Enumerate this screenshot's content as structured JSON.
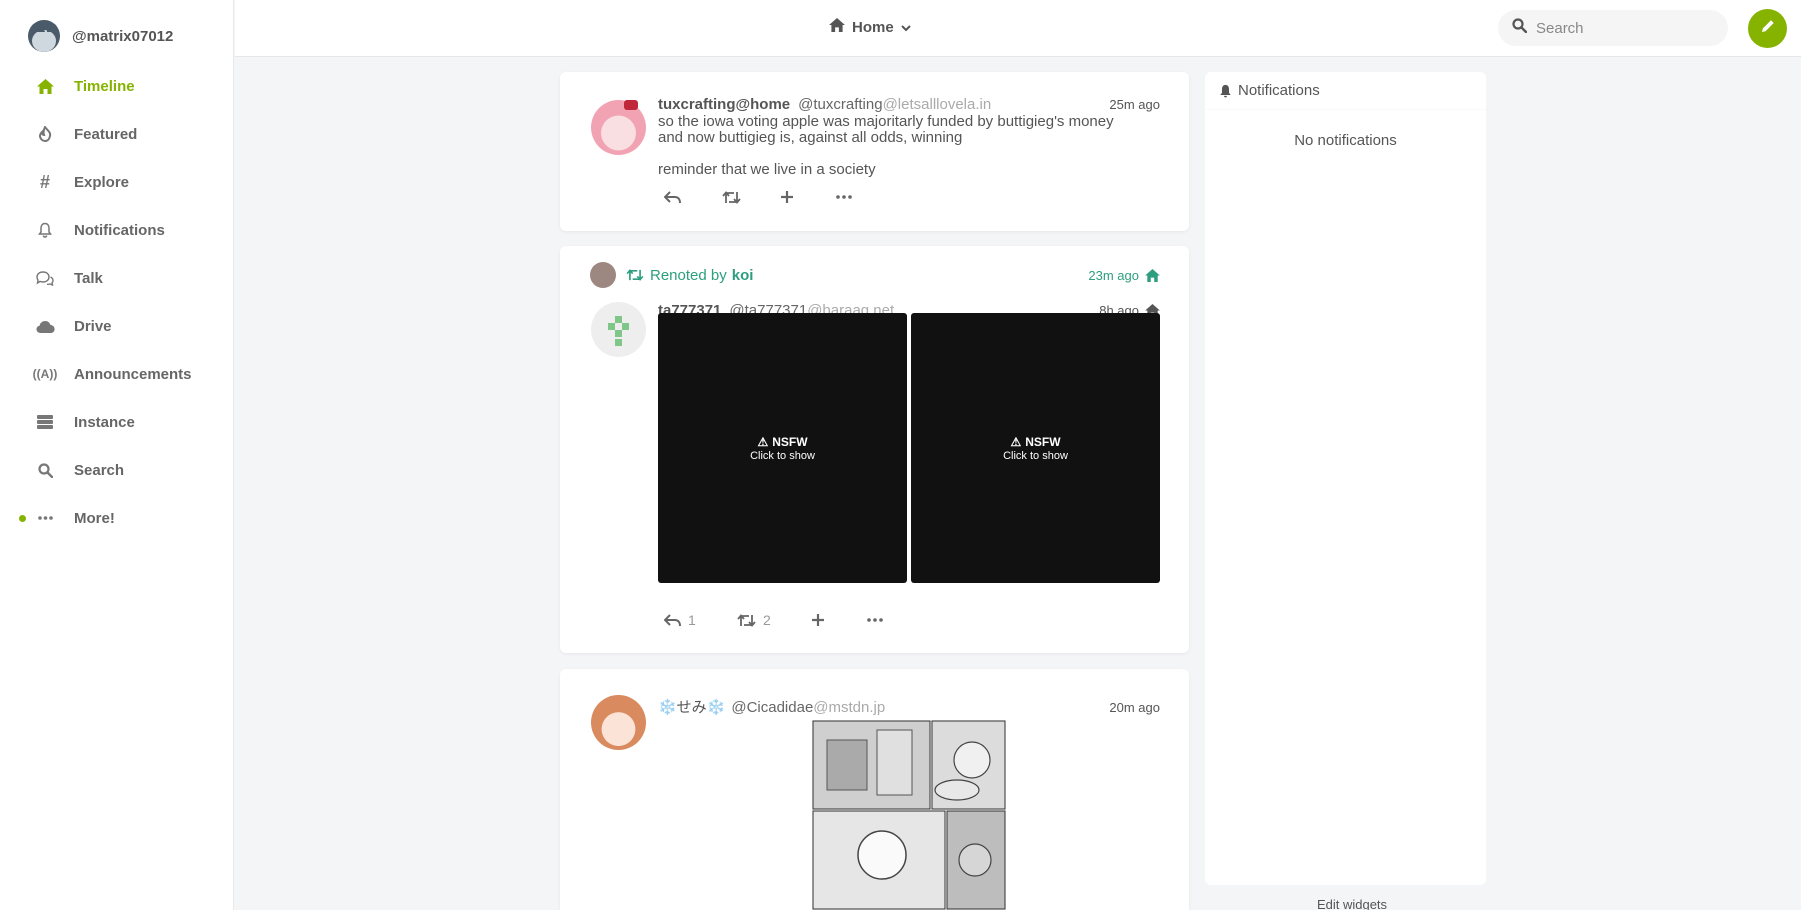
{
  "account": {
    "username": "@matrix07012"
  },
  "nav": [
    {
      "label": "Timeline",
      "icon": "home-icon"
    },
    {
      "label": "Featured",
      "icon": "fire-icon"
    },
    {
      "label": "Explore",
      "icon": "hash-icon"
    },
    {
      "label": "Notifications",
      "icon": "bell-icon"
    },
    {
      "label": "Talk",
      "icon": "comments-icon"
    },
    {
      "label": "Drive",
      "icon": "cloud-icon"
    },
    {
      "label": "Announcements",
      "icon": "broadcast-icon"
    },
    {
      "label": "Instance",
      "icon": "server-icon"
    },
    {
      "label": "Search",
      "icon": "search-icon"
    },
    {
      "label": "More!",
      "icon": "ellipsis-icon"
    }
  ],
  "header": {
    "title": "Home",
    "search_placeholder": "Search"
  },
  "colors": {
    "accent": "#86b300",
    "renote": "#2d9e7f"
  },
  "notes": [
    {
      "name": "tuxcrafting@home",
      "acct": "@tuxcrafting",
      "host": "@letsalllovela.in",
      "time": "25m ago",
      "text1": "so the iowa voting apple was majoritarly funded by buttigieg's money",
      "text2": "and now buttigieg is, against all odds, winning",
      "text3": "reminder that we live in a society"
    },
    {
      "renote_prefix": "Renoted by",
      "renoter": "koi",
      "renote_time": "23m ago",
      "name": "ta777371",
      "acct": "@ta777371",
      "host": "@baraag.net",
      "time": "8h ago",
      "media": [
        {
          "label": "NSFW",
          "sub": "Click to show"
        },
        {
          "label": "NSFW",
          "sub": "Click to show"
        }
      ],
      "replies": "1",
      "renotes": "2"
    },
    {
      "name": "❄️せみ❄️",
      "acct": "@Cicadidae",
      "host": "@mstdn.jp",
      "time": "20m ago"
    }
  ],
  "widget": {
    "title": "Notifications",
    "empty": "No notifications",
    "edit": "Edit widgets"
  }
}
